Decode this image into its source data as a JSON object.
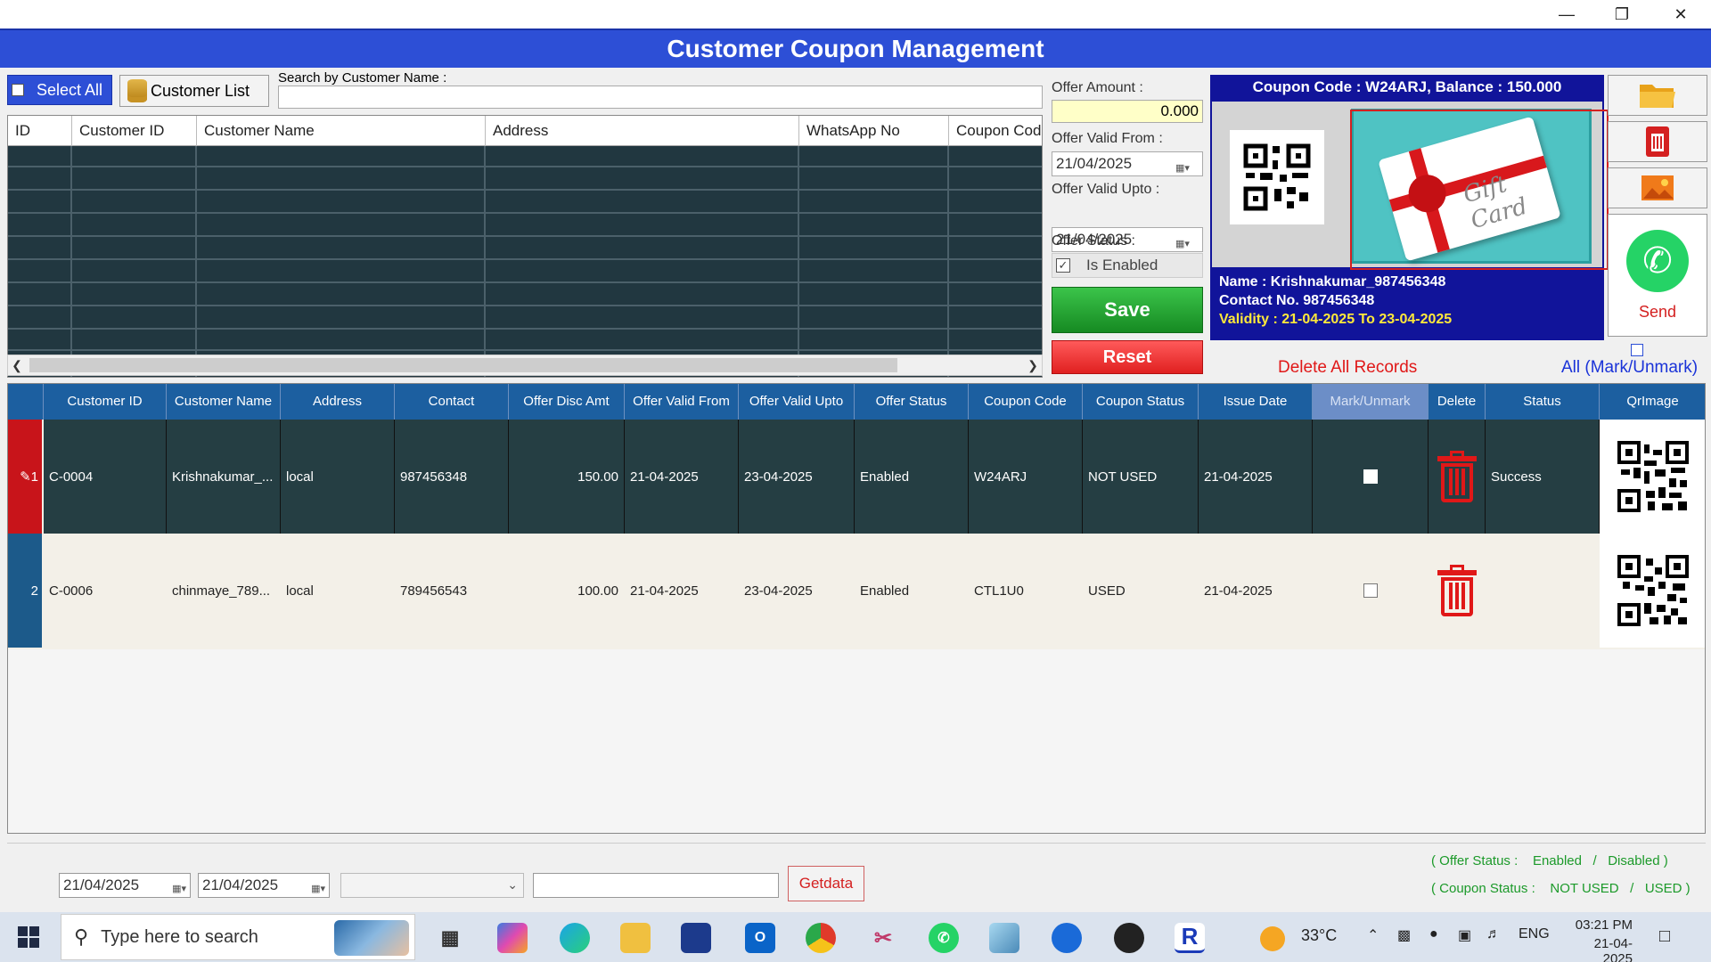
{
  "window": {
    "minimize_glyph": "—",
    "restore_glyph": "❐",
    "close_glyph": "✕"
  },
  "app": {
    "title": "Customer Coupon Management"
  },
  "top_controls": {
    "select_all": "Select All",
    "customer_list": "Customer List",
    "search_label": "Search by Customer Name :",
    "search_value": ""
  },
  "upper_grid": {
    "columns": [
      "ID",
      "Customer ID",
      "Customer Name",
      "Address",
      "WhatsApp No",
      "Coupon Cod"
    ]
  },
  "offer": {
    "amount_label": "Offer Amount :",
    "amount_value": "0.000",
    "valid_from_label": "Offer Valid From :",
    "valid_from": "21/04/2025",
    "valid_upto_label": "Offer Valid Upto :",
    "valid_upto": "21/04/2025",
    "status_label": "Offer Status :",
    "is_enabled": "Is Enabled",
    "is_enabled_check": "✓",
    "save": "Save",
    "reset": "Reset"
  },
  "coupon_card": {
    "header": "Coupon Code : W24ARJ, Balance : 150.000",
    "gift_text": "Gift Card",
    "name_line": "Name : Krishnakumar_987456348",
    "contact_line": "Contact No. 987456348",
    "validity_line": "Validity : 21-04-2025 To 23-04-2025"
  },
  "side": {
    "send": "Send",
    "delete_all": "Delete All Records",
    "mark_all": "All (Mark/Unmark)"
  },
  "main_grid": {
    "columns": [
      "Customer ID",
      "Customer Name",
      "Address",
      "Contact",
      "Offer Disc Amt",
      "Offer Valid From",
      "Offer Valid Upto",
      "Offer Status",
      "Coupon Code",
      "Coupon Status",
      "Issue Date",
      "Mark/Unmark",
      "Delete",
      "Status",
      "QrImage"
    ],
    "rows": [
      {
        "row_header": "1",
        "edit_glyph": "✎",
        "customer_id": "C-0004",
        "customer_name": "Krishnakumar_...",
        "address": "local",
        "contact": "987456348",
        "disc_amt": "150.00",
        "valid_from": "21-04-2025",
        "valid_upto": "23-04-2025",
        "offer_status": "Enabled",
        "coupon_code": "W24ARJ",
        "coupon_status": "NOT USED",
        "issue_date": "21-04-2025",
        "status": "Success"
      },
      {
        "row_header": "2",
        "customer_id": "C-0006",
        "customer_name": "chinmaye_789...",
        "address": "local",
        "contact": "789456543",
        "disc_amt": "100.00",
        "valid_from": "21-04-2025",
        "valid_upto": "23-04-2025",
        "offer_status": "Enabled",
        "coupon_code": "CTL1U0",
        "coupon_status": "USED",
        "issue_date": "21-04-2025",
        "status": ""
      }
    ]
  },
  "footer": {
    "date_from": "21/04/2025",
    "date_to": "21/04/2025",
    "combo_value": "",
    "text_value": "",
    "getdata": "Getdata",
    "legend_offer_a": "( Offer Status :",
    "legend_offer_b": "Enabled",
    "legend_offer_c": "/",
    "legend_offer_d": "Disabled )",
    "legend_coupon_a": "( Coupon Status :",
    "legend_coupon_b": "NOT USED",
    "legend_coupon_c": "/",
    "legend_coupon_d": "USED )"
  },
  "taskbar": {
    "search_placeholder": "Type here to search",
    "temperature": "33°C",
    "lang": "ENG",
    "time": "03:21 PM",
    "date": "21-04-2025"
  },
  "colors": {
    "title_bar": "#2d4fd6",
    "grid_header": "#1c5fa0",
    "row_selected": "#253e43",
    "save": "#1e9a2a",
    "reset": "#e02020",
    "accent_red": "#e01818"
  }
}
